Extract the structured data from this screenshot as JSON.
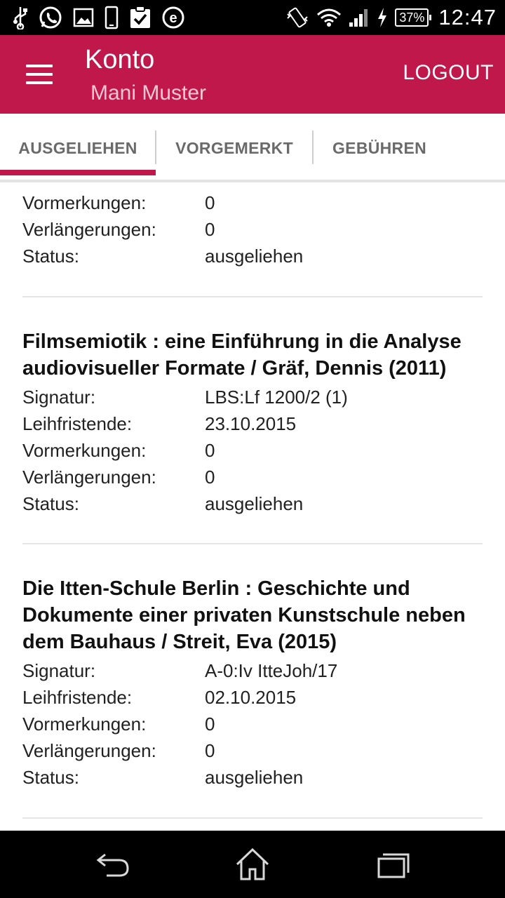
{
  "status_bar": {
    "battery": "37%",
    "time": "12:47",
    "icons": [
      "usb-icon",
      "whatsapp-icon",
      "image-icon",
      "phone-icon",
      "clipboard-check-icon",
      "e-icon",
      "vibrate-icon",
      "wifi-icon",
      "signal-icon",
      "charging-icon",
      "battery-icon"
    ]
  },
  "app_bar": {
    "title": "Konto",
    "subtitle": "Mani Muster",
    "logout_label": "LOGOUT",
    "color": "#c0184a"
  },
  "tabs": [
    {
      "label": "AUSGELIEHEN",
      "active": true
    },
    {
      "label": "VORGEMERKT",
      "active": false
    },
    {
      "label": "GEBÜHREN",
      "active": false
    }
  ],
  "labels": {
    "signatur": "Signatur:",
    "leihfristende": "Leihfristende:",
    "vormerkungen": "Vormerkungen:",
    "verlaengerungen": "Verlängerungen:",
    "status": "Status:"
  },
  "items": [
    {
      "vormerkungen": "0",
      "verlaengerungen": "0",
      "status": "ausgeliehen"
    },
    {
      "title": "Filmsemiotik : eine Einführung in die Analyse audiovisueller Formate / Gräf, Dennis (2011)",
      "signatur": "LBS:Lf 1200/2 (1)",
      "leihfristende": "23.10.2015",
      "vormerkungen": "0",
      "verlaengerungen": "0",
      "status": "ausgeliehen"
    },
    {
      "title": "Die Itten-Schule Berlin : Geschichte und Dokumente einer privaten Kunstschule neben dem Bauhaus / Streit, Eva (2015)",
      "signatur": "A-0:Iv IttеJoh/17",
      "leihfristende": "02.10.2015",
      "vormerkungen": "0",
      "verlaengerungen": "0",
      "status": "ausgeliehen"
    }
  ],
  "nav_bar": {
    "icons": [
      "back-icon",
      "home-icon",
      "recents-icon"
    ]
  }
}
